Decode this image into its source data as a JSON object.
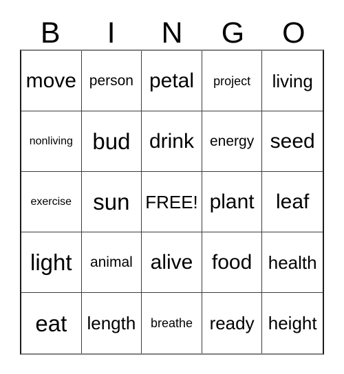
{
  "card": {
    "title": "BINGO",
    "header_letters": [
      "B",
      "I",
      "N",
      "G",
      "O"
    ],
    "free_space_label": "FREE!",
    "colors": {
      "text": "#000000",
      "background": "#ffffff",
      "grid_line": "#3a3a3a",
      "outer_border": "#1a1a1a"
    },
    "grid": {
      "columns": 5,
      "rows": 5,
      "cells": [
        [
          {
            "text": "move",
            "size": "lg"
          },
          {
            "text": "person",
            "size": "sm"
          },
          {
            "text": "petal",
            "size": "lg"
          },
          {
            "text": "project",
            "size": "xs"
          },
          {
            "text": "living",
            "size": "md"
          }
        ],
        [
          {
            "text": "nonliving",
            "size": "xxs"
          },
          {
            "text": "bud",
            "size": "xl"
          },
          {
            "text": "drink",
            "size": "lg"
          },
          {
            "text": "energy",
            "size": "sm"
          },
          {
            "text": "seed",
            "size": "lg"
          }
        ],
        [
          {
            "text": "exercise",
            "size": "xxs"
          },
          {
            "text": "sun",
            "size": "xl"
          },
          {
            "text": "FREE!",
            "size": "md"
          },
          {
            "text": "plant",
            "size": "lg"
          },
          {
            "text": "leaf",
            "size": "lg"
          }
        ],
        [
          {
            "text": "light",
            "size": "xl"
          },
          {
            "text": "animal",
            "size": "sm"
          },
          {
            "text": "alive",
            "size": "lg"
          },
          {
            "text": "food",
            "size": "lg"
          },
          {
            "text": "health",
            "size": "md"
          }
        ],
        [
          {
            "text": "eat",
            "size": "xl"
          },
          {
            "text": "length",
            "size": "md"
          },
          {
            "text": "breathe",
            "size": "xs"
          },
          {
            "text": "ready",
            "size": "md"
          },
          {
            "text": "height",
            "size": "md"
          }
        ]
      ]
    }
  }
}
